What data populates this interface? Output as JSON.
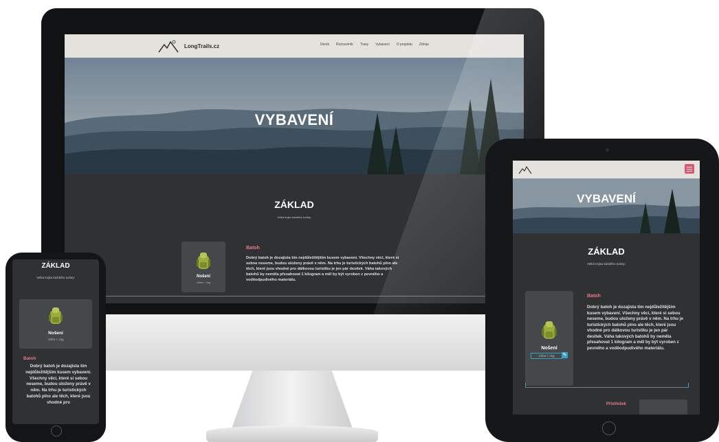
{
  "desktop": {
    "brand": "LongTrails.cz",
    "nav": [
      "Deník",
      "Rozcestník",
      "Trasy",
      "Vybavení",
      "O projektu",
      "Zdroje"
    ],
    "hero_title": "VYBAVENÍ",
    "section_title": "ZÁKLAD",
    "section_subtitle": "Velká trojka každého turisty:",
    "card": {
      "title": "Nošení",
      "weight": "Váha < 1kg"
    },
    "item": {
      "title": "Batoh",
      "description": "Dobrý batoh je dozajista tím nejdůležitějším kusem vybavení. Všechny věci, které si sebou neseme, budou uloženy právě v něm. Na trhu je turistických batohů plno ale těch, které jsou vhodné pro dálkovou turistiku je jen pár desítek. Váha takových batohů by neměla přesahovat 1 kilogram a měl by být vyroben z pevného a voděodpudivého materiálu."
    }
  },
  "tablet": {
    "hero_title": "VYBAVENÍ",
    "section_title": "ZÁKLAD",
    "section_subtitle": "Velká trojka každého turisty:",
    "card": {
      "title": "Nošení",
      "weight": "Váha < 1kg"
    },
    "item": {
      "title": "Batoh",
      "description": "Dobrý batoh je dozajista tím nejdůležitějším kusem vybavení. Všechny věci, které si sebou neseme, budou uloženy právě v něm. Na trhu je turistických batohů plno ale těch, které jsou vhodné pro dálkovou turistiku je jen pár desítek. Váha takových batohů by neměla přesahovat 1 kilogram a měl by být vyroben z pevného a voděodpudivého materiálu."
    },
    "next_item_title": "Přístřešek",
    "menu_icon": "hamburger-icon"
  },
  "phone": {
    "section_title": "ZÁKLAD",
    "section_subtitle": "Velká trojka každého turisty:",
    "card": {
      "title": "Nošení",
      "weight": "Váha < 1kg"
    },
    "item": {
      "title": "Batoh",
      "description": "Dobrý batoh je dozajista tím nejdůležitějším kusem vybavení. Všechny věci, které si sebou neseme, budou uloženy právě v něm. Na trhu je turistických batohů plno ale těch, které jsou vhodné pro"
    }
  },
  "colors": {
    "accent": "#e05470",
    "item_title": "#e87a8a",
    "page_bg": "#2f3133",
    "card_bg": "#45484b",
    "nav_bg": "#e4e2dd",
    "focus": "#3aa0c8"
  }
}
